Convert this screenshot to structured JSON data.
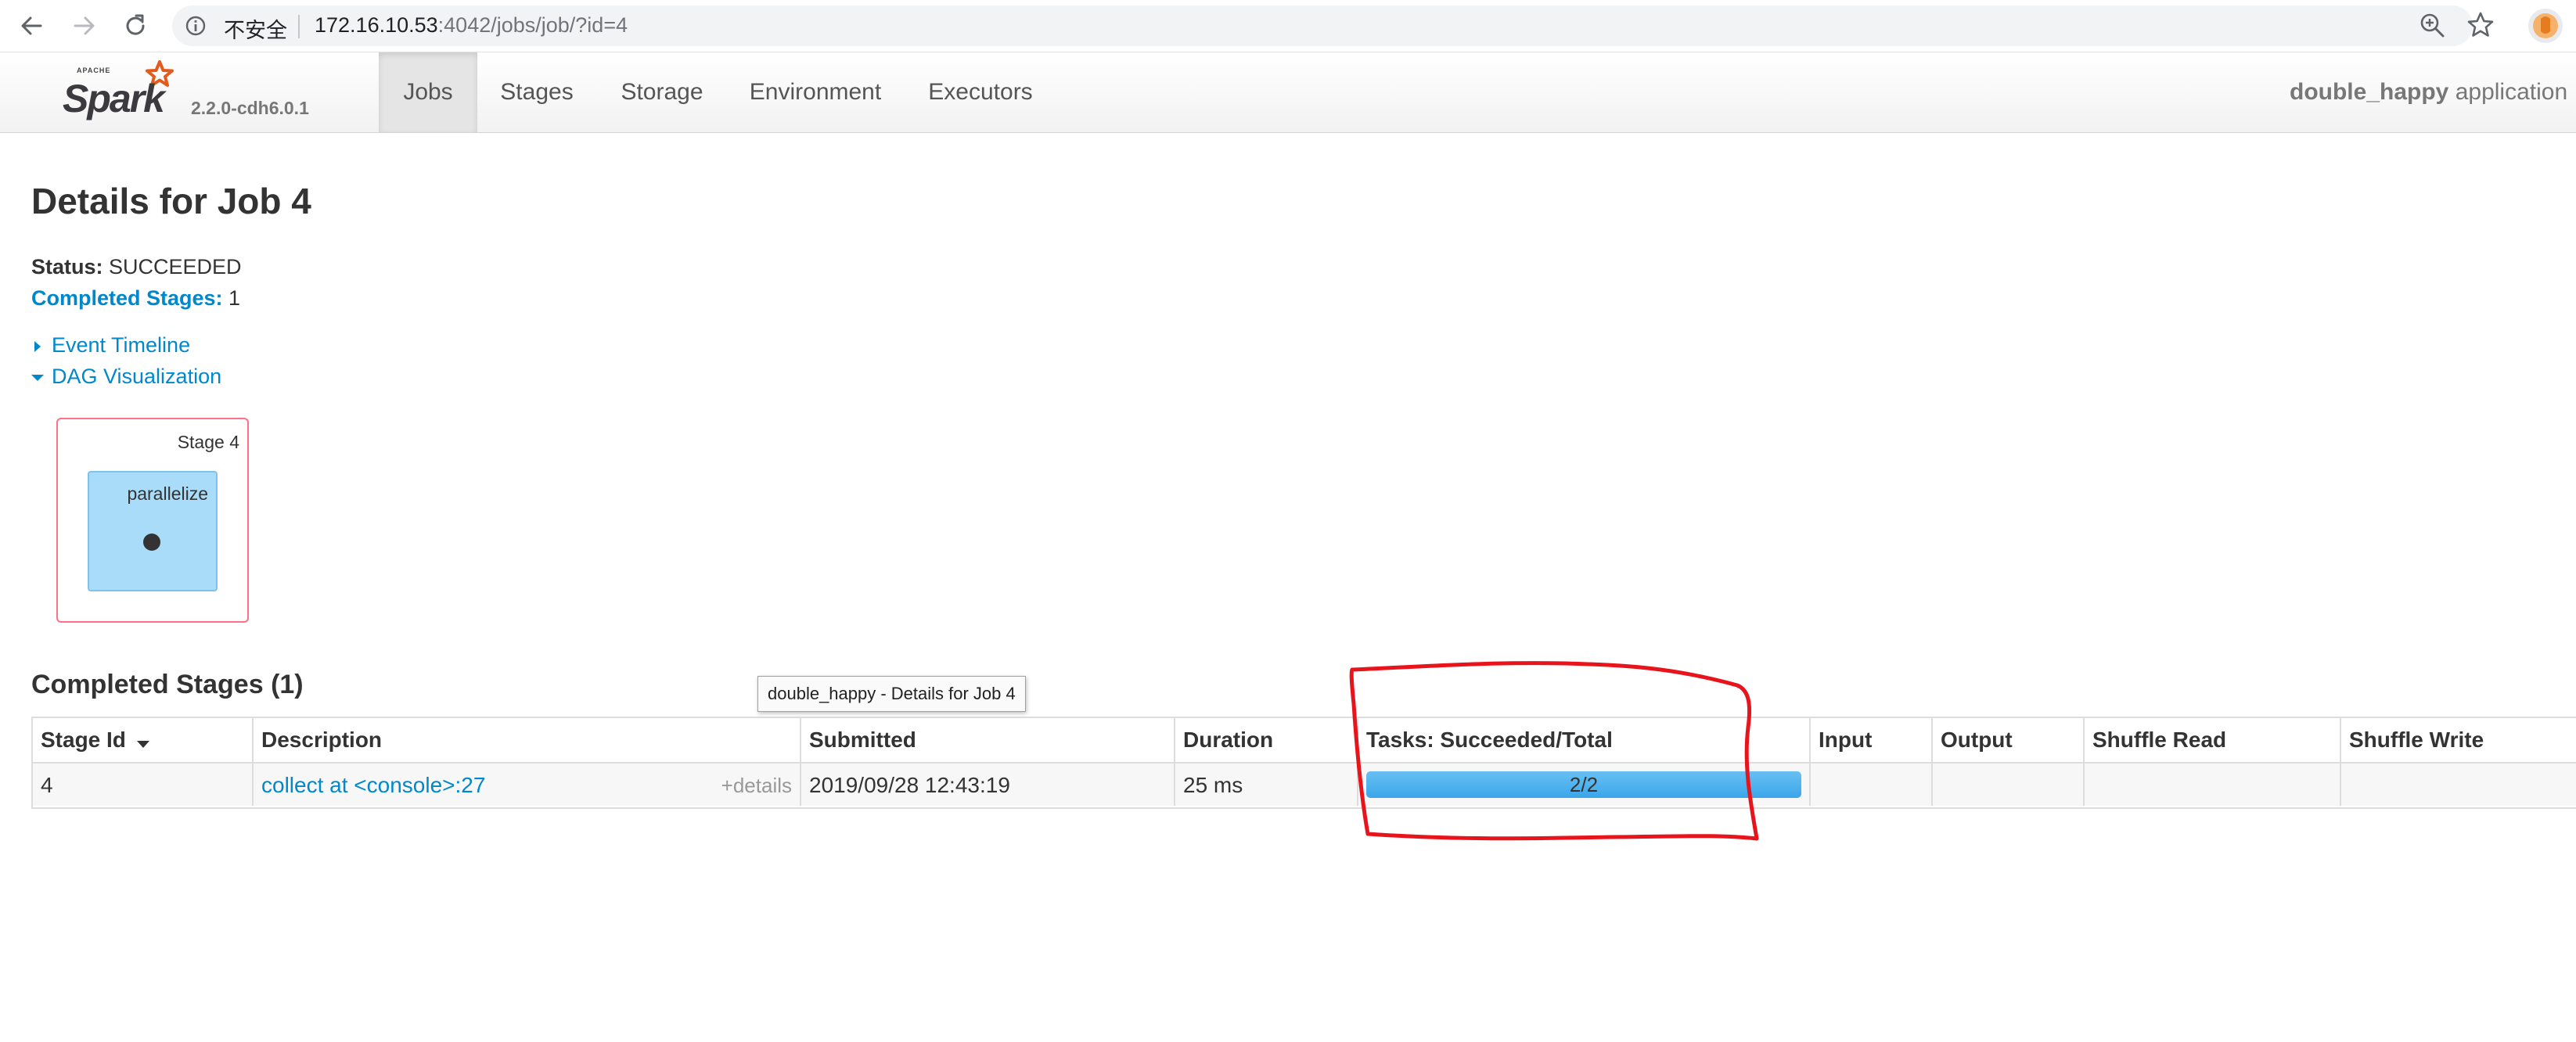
{
  "browser": {
    "security_label": "不安全",
    "url_host": "172.16.10.53",
    "url_rest": ":4042/jobs/job/?id=4",
    "icons": [
      "back-icon",
      "forward-icon",
      "reload-icon",
      "info-icon",
      "zoom-icon",
      "star-icon",
      "profile-icon"
    ]
  },
  "navbar": {
    "version": "2.2.0-cdh6.0.1",
    "tabs": [
      {
        "label": "Jobs",
        "active": true
      },
      {
        "label": "Stages",
        "active": false
      },
      {
        "label": "Storage",
        "active": false
      },
      {
        "label": "Environment",
        "active": false
      },
      {
        "label": "Executors",
        "active": false
      }
    ],
    "app_name": "double_happy",
    "app_suffix": " application"
  },
  "page": {
    "title": "Details for Job 4",
    "status_key": "Status:",
    "status_value": " SUCCEEDED",
    "completed_key": "Completed Stages:",
    "completed_value": " 1",
    "event_timeline": "Event Timeline",
    "dag_visualization": "DAG Visualization"
  },
  "dag": {
    "stage_label": "Stage 4",
    "rdd_label": "parallelize"
  },
  "completed_stages": {
    "title": "Completed Stages (1)",
    "tooltip": "double_happy - Details for Job 4",
    "headers": {
      "stage_id": "Stage Id",
      "description": "Description",
      "submitted": "Submitted",
      "duration": "Duration",
      "tasks": "Tasks: Succeeded/Total",
      "input": "Input",
      "output": "Output",
      "shuffle_read": "Shuffle Read",
      "shuffle_write": "Shuffle Write"
    },
    "rows": [
      {
        "stage_id": "4",
        "description": "collect at <console>:27",
        "details": "+details",
        "submitted": "2019/09/28 12:43:19",
        "duration": "25 ms",
        "tasks_text": "2/2",
        "tasks_succeeded": 2,
        "tasks_total": 2,
        "input": "",
        "output": "",
        "shuffle_read": "",
        "shuffle_write": ""
      }
    ]
  },
  "colors": {
    "link": "#0088cc",
    "progress_fill": "#3aa6ea",
    "dag_stage_border": "#ff6f86",
    "dag_rdd_fill": "#a8dcf9",
    "annotation": "#e8141c"
  }
}
